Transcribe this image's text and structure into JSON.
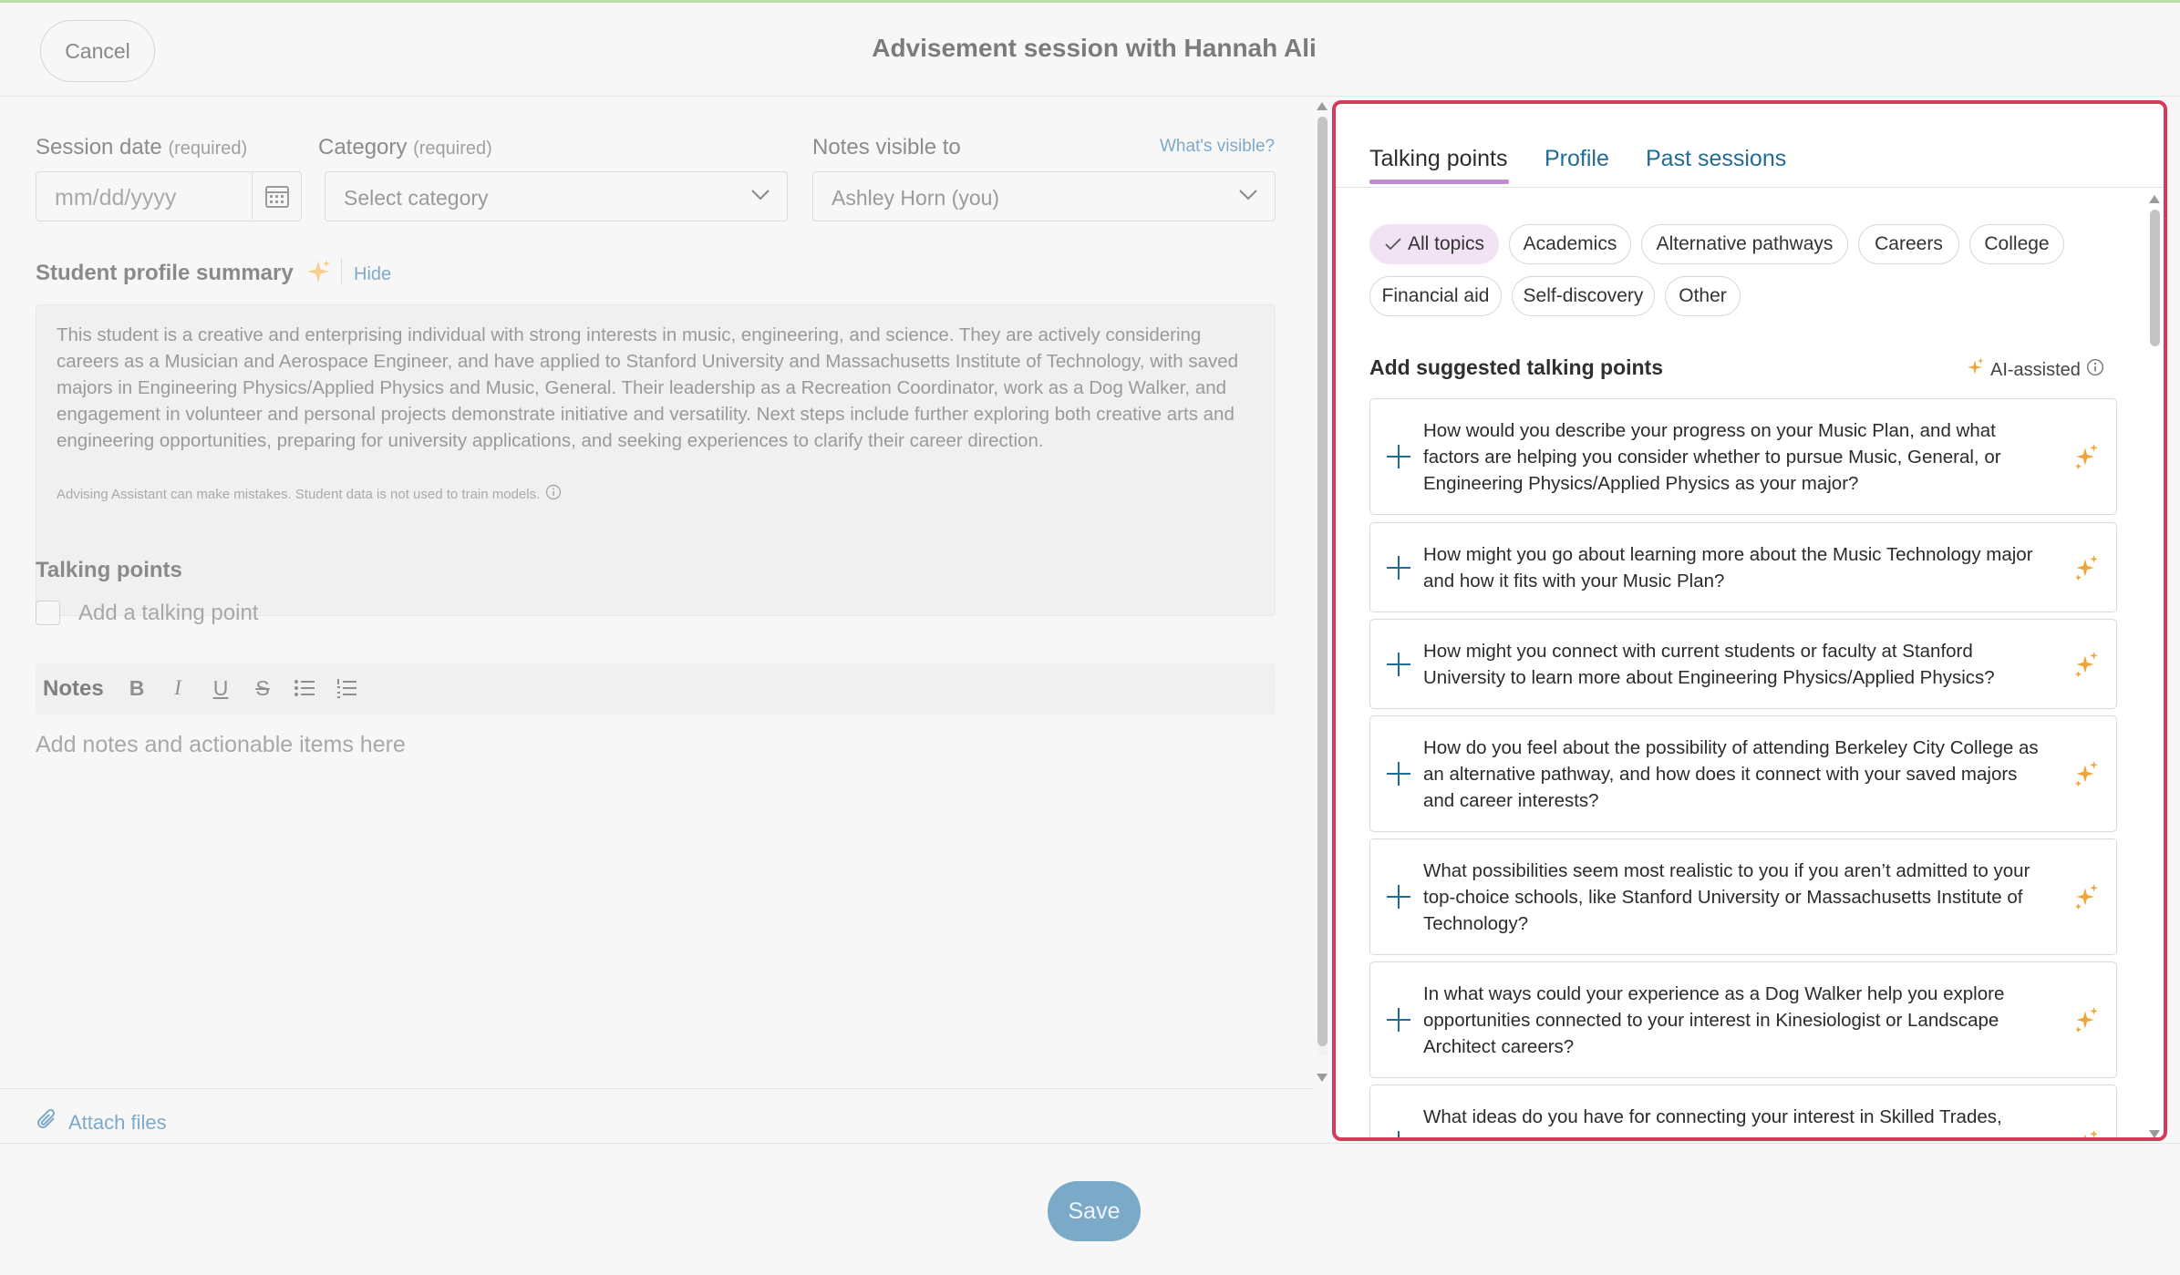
{
  "header": {
    "cancel_label": "Cancel",
    "title": "Advisement session with Hannah Ali"
  },
  "form": {
    "session_date_label": "Session date",
    "session_date_req": "(required)",
    "session_date_placeholder": "mm/dd/yyyy",
    "category_label": "Category",
    "category_req": "(required)",
    "category_value": "Select category",
    "notes_visible_label": "Notes visible to",
    "whats_visible": "What's visible?",
    "notes_visible_value": "Ashley Horn (you)"
  },
  "summary": {
    "title": "Student profile summary",
    "hide_label": "Hide",
    "text": "This student is a creative and enterprising individual with strong interests in music, engineering, and science. They are actively considering careers as a Musician and Aerospace Engineer, and have applied to Stanford University and Massachusetts Institute of Technology, with saved majors in Engineering Physics/Applied Physics and Music, General. Their leadership as a Recreation Coordinator, work as a Dog Walker, and engagement in volunteer and personal projects demonstrate initiative and versatility. Next steps include further exploring both creative arts and engineering opportunities, preparing for university applications, and seeking experiences to clarify their career direction.",
    "disclaimer": "Advising Assistant can make mistakes. Student data is not used to train models."
  },
  "talking_points": {
    "title": "Talking points",
    "add_placeholder": "Add a talking point"
  },
  "notes": {
    "toolbar_label": "Notes",
    "placeholder": "Add notes and actionable items here"
  },
  "attach_label": "Attach files",
  "save_label": "Save",
  "panel": {
    "tabs": [
      "Talking points",
      "Profile",
      "Past sessions"
    ],
    "active_tab": "Talking points",
    "chips": [
      "All topics",
      "Academics",
      "Alternative pathways",
      "Careers",
      "College",
      "Financial aid",
      "Self-discovery",
      "Other"
    ],
    "active_chip": "All topics",
    "suggested_title": "Add suggested talking points",
    "ai_assisted_label": "AI-assisted",
    "suggestions": [
      "How would you describe your progress on your Music Plan, and what factors are helping you consider whether to pursue Music, General, or Engineering Physics/Applied Physics as your major?",
      "How might you go about learning more about the Music Technology major and how it fits with your Music Plan?",
      "How might you connect with current students or faculty at Stanford University to learn more about Engineering Physics/Applied Physics?",
      "How do you feel about the possibility of attending Berkeley City College as an alternative pathway, and how does it connect with your saved majors and career interests?",
      "What possibilities seem most realistic to you if you aren’t admitted to your top-choice schools, like Stanford University or Massachusetts Institute of Technology?",
      "In what ways could your experience as a Dog Walker help you explore opportunities connected to your interest in Kinesiologist or Landscape Architect careers?",
      "What ideas do you have for connecting your interest in Skilled Trades,"
    ]
  },
  "colors": {
    "accent": "#216c96",
    "highlight_border": "#d43a5a",
    "active_tab_underline": "#c08bcf",
    "active_chip_bg": "#f1e2f4",
    "spark": "#f0a53a",
    "save_bg": "#7ba9c8"
  },
  "icons": {
    "calendar": "calendar-icon",
    "chevron": "chevron-down-icon",
    "sparkle": "sparkle-icon",
    "info": "info-icon",
    "paperclip": "paperclip-icon",
    "plus": "plus-icon",
    "check": "check-icon"
  }
}
